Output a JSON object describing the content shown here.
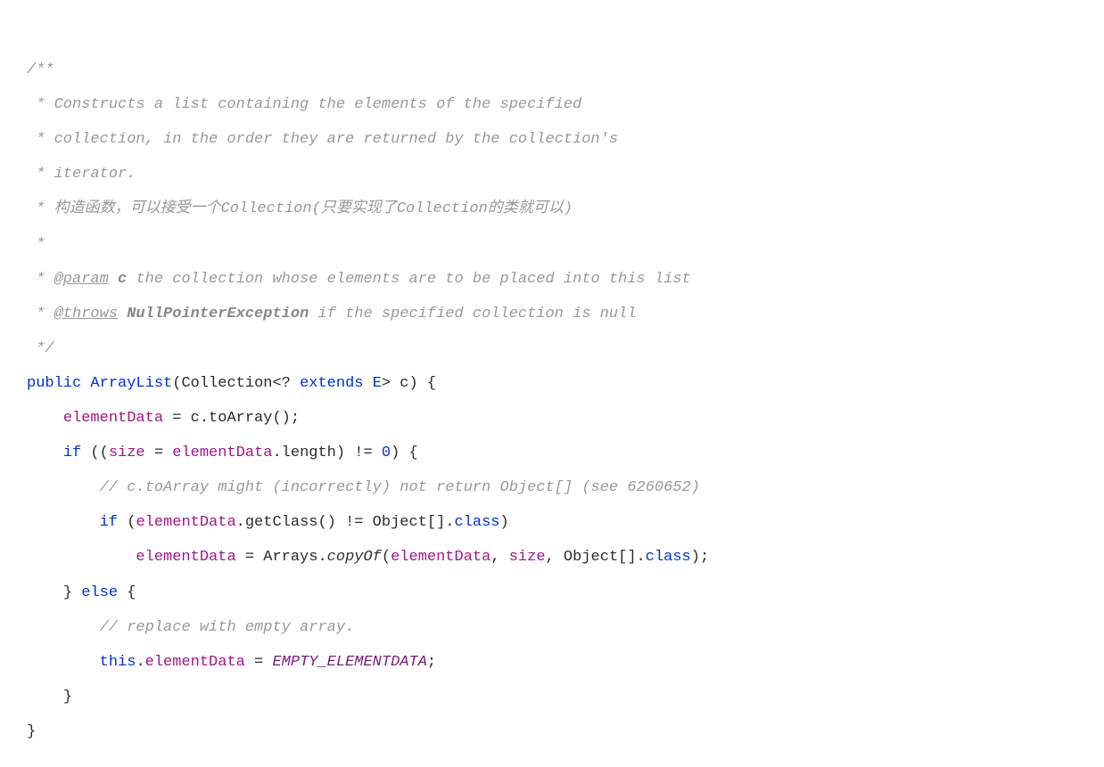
{
  "code": {
    "l1": "/**",
    "l2": " * Constructs a list containing the elements of the specified",
    "l3": " * collection, in the order they are returned by the collection's",
    "l4": " * iterator.",
    "l5": " * 构造函数，可以接受一个Collection(只要实现了Collection的类就可以)",
    "l6": " *",
    "l7_star": " * ",
    "l7_tag": "@param",
    "l7_name": " c ",
    "l7_rest": "the collection whose elements are to be placed into this list",
    "l8_star": " * ",
    "l8_tag": "@throws",
    "l8_name": " NullPointerException ",
    "l8_rest": "if the specified collection is null",
    "l9": " */",
    "l10_public": "public",
    "l10_name": " ArrayList",
    "l10_open": "(Collection<? ",
    "l10_extends": "extends",
    "l10_e": " E",
    "l10_rest": "> c) {",
    "l11_field": "elementData",
    "l11_rest": " = c.toArray();",
    "l12_if": "if",
    "l12_open": " ((",
    "l12_size": "size",
    "l12_eq": " = ",
    "l12_ed": "elementData",
    "l12_len": ".length) != ",
    "l12_zero": "0",
    "l12_close": ") {",
    "l13": "// c.toArray might (incorrectly) not return Object[] (see 6260652)",
    "l14_if": "if",
    "l14_open": " (",
    "l14_ed": "elementData",
    "l14_mid": ".getClass() != Object[].",
    "l14_class": "class",
    "l14_close": ")",
    "l15_ed": "elementData",
    "l15_eq": " = Arrays.",
    "l15_copy": "copyOf",
    "l15_open": "(",
    "l15_ed2": "elementData",
    "l15_comma": ", ",
    "l15_size": "size",
    "l15_mid": ", Object[].",
    "l15_class": "class",
    "l15_close": ");",
    "l16_close": "} ",
    "l16_else": "else",
    "l16_open": " {",
    "l17": "// replace with empty array.",
    "l18_this": "this",
    "l18_dot": ".",
    "l18_ed": "elementData",
    "l18_eq": " = ",
    "l18_const": "EMPTY_ELEMENTDATA",
    "l18_semi": ";",
    "l19": "}",
    "l20": "}"
  }
}
